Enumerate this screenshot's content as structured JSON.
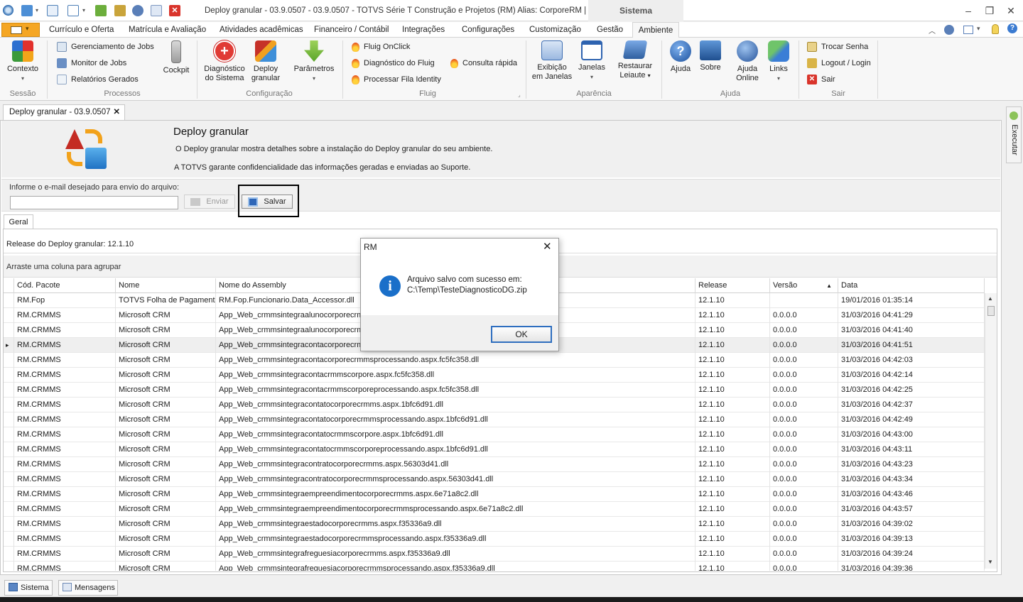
{
  "titlebar": {
    "title": "Deploy granular - 03.9.0507 - 03.9.0507 - TOTVS Série T Construção e Projetos (RM) Alias: CorporeRM | 1-T...",
    "context_tab": "Sistema"
  },
  "menu_tabs": [
    "Currículo e Oferta",
    "Matrícula e Avaliação",
    "Atividades acadêmicas",
    "Financeiro / Contábil",
    "Integrações",
    "Configurações",
    "Customização",
    "Gestão",
    "Ambiente"
  ],
  "ribbon": {
    "sessao": {
      "contexto": "Contexto",
      "group": "Sessão"
    },
    "processos": {
      "items": [
        "Gerenciamento de Jobs",
        "Monitor de Jobs",
        "Relatórios Gerados"
      ],
      "cockpit": "Cockpit",
      "group": "Processos"
    },
    "configuracao": {
      "diag_l1": "Diagnóstico",
      "diag_l2": "do Sistema",
      "deploy_l1": "Deploy",
      "deploy_l2": "granular",
      "parametros": "Parâmetros",
      "group": "Configuração"
    },
    "fluig": {
      "items": [
        "Fluig OnClick",
        "Diagnóstico do Fluig",
        "Processar Fila Identity"
      ],
      "consulta": "Consulta rápida",
      "group": "Fluig"
    },
    "aparencia": {
      "exib_l1": "Exibição",
      "exib_l2": "em Janelas",
      "janelas": "Janelas",
      "rest_l1": "Restaurar",
      "rest_l2": "Leiaute",
      "group": "Aparência"
    },
    "ajuda": {
      "ajuda": "Ajuda",
      "sobre": "Sobre",
      "online_l1": "Ajuda",
      "online_l2": "Online",
      "links": "Links",
      "group": "Ajuda"
    },
    "sair": {
      "items": [
        "Trocar Senha",
        "Logout / Login",
        "Sair"
      ],
      "group": "Sair"
    }
  },
  "doc_tab": {
    "label": "Deploy granular - 03.9.0507"
  },
  "header": {
    "title": "Deploy granular",
    "desc1": "O Deploy granular mostra detalhes sobre a instalação do Deploy granular do seu ambiente.",
    "desc2": "A TOTVS garante confidencialidade das informações geradas e enviadas ao Suporte."
  },
  "form": {
    "email_label": "Informe o e-mail desejado para envio do arquivo:",
    "email_value": "",
    "enviar": "Enviar",
    "salvar": "Salvar"
  },
  "inner_tab": "Geral",
  "release_line": "Release do Deploy granular:  12.1.10",
  "group_hint": "Arraste uma coluna para agrupar",
  "grid": {
    "columns": [
      "Cód. Pacote",
      "Nome",
      "Nome do Assembly",
      "Release",
      "Versão",
      "Data"
    ],
    "rows": [
      [
        "RM.Fop",
        "TOTVS Folha de Pagamento",
        "RM.Fop.Funcionario.Data_Accessor.dll",
        "12.1.10",
        "",
        "19/01/2016 01:35:14"
      ],
      [
        "RM.CRMMS",
        "Microsoft CRM",
        "App_Web_crmmsintegraalunocorporecrmms.aspx.fc5fc358.dll",
        "12.1.10",
        "0.0.0.0",
        "31/03/2016 04:41:29"
      ],
      [
        "RM.CRMMS",
        "Microsoft CRM",
        "App_Web_crmmsintegraalunocorporecrmmsprocessando.aspx.fc5fc358.dll",
        "12.1.10",
        "0.0.0.0",
        "31/03/2016 04:41:40"
      ],
      [
        "RM.CRMMS",
        "Microsoft CRM",
        "App_Web_crmmsintegracontacorporecrmms.aspx.fc5fc358.dll",
        "12.1.10",
        "0.0.0.0",
        "31/03/2016 04:41:51"
      ],
      [
        "RM.CRMMS",
        "Microsoft CRM",
        "App_Web_crmmsintegracontacorporecrmmsprocessando.aspx.fc5fc358.dll",
        "12.1.10",
        "0.0.0.0",
        "31/03/2016 04:42:03"
      ],
      [
        "RM.CRMMS",
        "Microsoft CRM",
        "App_Web_crmmsintegracontacrmmscorpore.aspx.fc5fc358.dll",
        "12.1.10",
        "0.0.0.0",
        "31/03/2016 04:42:14"
      ],
      [
        "RM.CRMMS",
        "Microsoft CRM",
        "App_Web_crmmsintegracontacrmmscorporeprocessando.aspx.fc5fc358.dll",
        "12.1.10",
        "0.0.0.0",
        "31/03/2016 04:42:25"
      ],
      [
        "RM.CRMMS",
        "Microsoft CRM",
        "App_Web_crmmsintegracontatocorporecrmms.aspx.1bfc6d91.dll",
        "12.1.10",
        "0.0.0.0",
        "31/03/2016 04:42:37"
      ],
      [
        "RM.CRMMS",
        "Microsoft CRM",
        "App_Web_crmmsintegracontatocorporecrmmsprocessando.aspx.1bfc6d91.dll",
        "12.1.10",
        "0.0.0.0",
        "31/03/2016 04:42:49"
      ],
      [
        "RM.CRMMS",
        "Microsoft CRM",
        "App_Web_crmmsintegracontatocrmmscorpore.aspx.1bfc6d91.dll",
        "12.1.10",
        "0.0.0.0",
        "31/03/2016 04:43:00"
      ],
      [
        "RM.CRMMS",
        "Microsoft CRM",
        "App_Web_crmmsintegracontatocrmmscorporeprocessando.aspx.1bfc6d91.dll",
        "12.1.10",
        "0.0.0.0",
        "31/03/2016 04:43:11"
      ],
      [
        "RM.CRMMS",
        "Microsoft CRM",
        "App_Web_crmmsintegracontratocorporecrmms.aspx.56303d41.dll",
        "12.1.10",
        "0.0.0.0",
        "31/03/2016 04:43:23"
      ],
      [
        "RM.CRMMS",
        "Microsoft CRM",
        "App_Web_crmmsintegracontratocorporecrmmsprocessando.aspx.56303d41.dll",
        "12.1.10",
        "0.0.0.0",
        "31/03/2016 04:43:34"
      ],
      [
        "RM.CRMMS",
        "Microsoft CRM",
        "App_Web_crmmsintegraempreendimentocorporecrmms.aspx.6e71a8c2.dll",
        "12.1.10",
        "0.0.0.0",
        "31/03/2016 04:43:46"
      ],
      [
        "RM.CRMMS",
        "Microsoft CRM",
        "App_Web_crmmsintegraempreendimentocorporecrmmsprocessando.aspx.6e71a8c2.dll",
        "12.1.10",
        "0.0.0.0",
        "31/03/2016 04:43:57"
      ],
      [
        "RM.CRMMS",
        "Microsoft CRM",
        "App_Web_crmmsintegraestadocorporecrmms.aspx.f35336a9.dll",
        "12.1.10",
        "0.0.0.0",
        "31/03/2016 04:39:02"
      ],
      [
        "RM.CRMMS",
        "Microsoft CRM",
        "App_Web_crmmsintegraestadocorporecrmmsprocessando.aspx.f35336a9.dll",
        "12.1.10",
        "0.0.0.0",
        "31/03/2016 04:39:13"
      ],
      [
        "RM.CRMMS",
        "Microsoft CRM",
        "App_Web_crmmsintegrafreguesiacorporecrmms.aspx.f35336a9.dll",
        "12.1.10",
        "0.0.0.0",
        "31/03/2016 04:39:24"
      ],
      [
        "RM.CRMMS",
        "Microsoft CRM",
        "App_Web_crmmsintegrafreguesiacorporecrmmsprocessando.aspx.f35336a9.dll",
        "12.1.10",
        "0.0.0.0",
        "31/03/2016 04:39:36"
      ]
    ]
  },
  "dialog": {
    "title": "RM",
    "msg1": "Arquivo salvo com sucesso em:",
    "msg2": "C:\\Temp\\TesteDiagnosticoDG.zip",
    "ok": "OK"
  },
  "statusbar": {
    "sistema": "Sistema",
    "mensagens": "Mensagens"
  },
  "side": {
    "executar": "Executar"
  },
  "colors": {
    "accent_orange": "#f5a623",
    "info_blue": "#1a6fc9",
    "close_red": "#d9342b"
  }
}
